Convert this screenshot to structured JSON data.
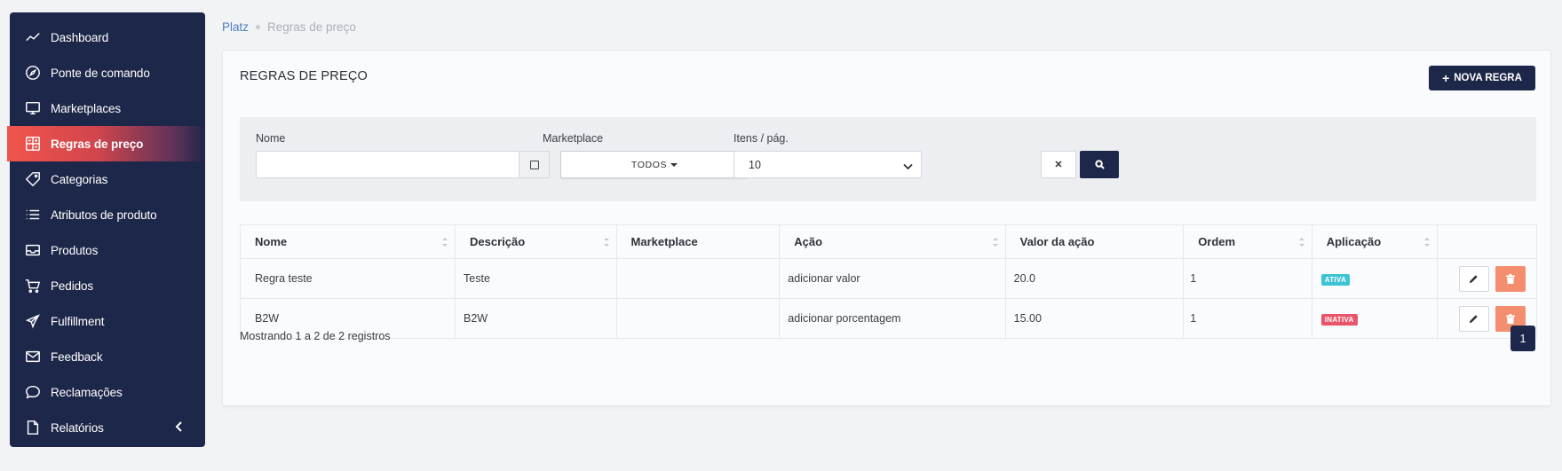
{
  "sidebar": {
    "items": [
      {
        "label": "Dashboard",
        "icon": "trend-line-icon"
      },
      {
        "label": "Ponte de comando",
        "icon": "compass-icon"
      },
      {
        "label": "Marketplaces",
        "icon": "monitor-icon"
      },
      {
        "label": "Regras de preço",
        "icon": "calculator-icon"
      },
      {
        "label": "Categorias",
        "icon": "tag-icon"
      },
      {
        "label": "Atributos de produto",
        "icon": "list-icon"
      },
      {
        "label": "Produtos",
        "icon": "inbox-icon"
      },
      {
        "label": "Pedidos",
        "icon": "cart-icon"
      },
      {
        "label": "Fulfillment",
        "icon": "plane-icon"
      },
      {
        "label": "Feedback",
        "icon": "mail-icon"
      },
      {
        "label": "Reclamações",
        "icon": "chat-bubble-icon"
      },
      {
        "label": "Relatórios",
        "icon": "document-icon"
      }
    ],
    "active_index": 3
  },
  "breadcrumb": {
    "root": "Platz",
    "current": "Regras de preço"
  },
  "page": {
    "title": "REGRAS DE PREÇO",
    "new_button": "NOVA REGRA"
  },
  "filters": {
    "name_label": "Nome",
    "name_value": "",
    "marketplace_label": "Marketplace",
    "marketplace_value": "TODOS",
    "items_label": "Itens / pág.",
    "items_value": "10"
  },
  "table": {
    "headers": [
      "Nome",
      "Descrição",
      "Marketplace",
      "Ação",
      "Valor da ação",
      "Ordem",
      "Aplicação"
    ],
    "rows": [
      {
        "nome": "Regra teste",
        "descricao": "Teste",
        "marketplace": "",
        "acao": "adicionar valor",
        "valor": "20.0",
        "ordem": "1",
        "aplicacao": "ATIVA"
      },
      {
        "nome": "B2W",
        "descricao": "B2W",
        "marketplace": "",
        "acao": "adicionar porcentagem",
        "valor": "15.00",
        "ordem": "1",
        "aplicacao": "INATIVA"
      }
    ]
  },
  "footer": {
    "info": "Mostrando 1 a 2 de 2 registros",
    "page": "1"
  },
  "colors": {
    "navy": "#1d2749",
    "active_status": "#3ec3d5",
    "inactive_status": "#e8556a",
    "delete": "#f58d6f",
    "accent_red": "#f0554b"
  }
}
